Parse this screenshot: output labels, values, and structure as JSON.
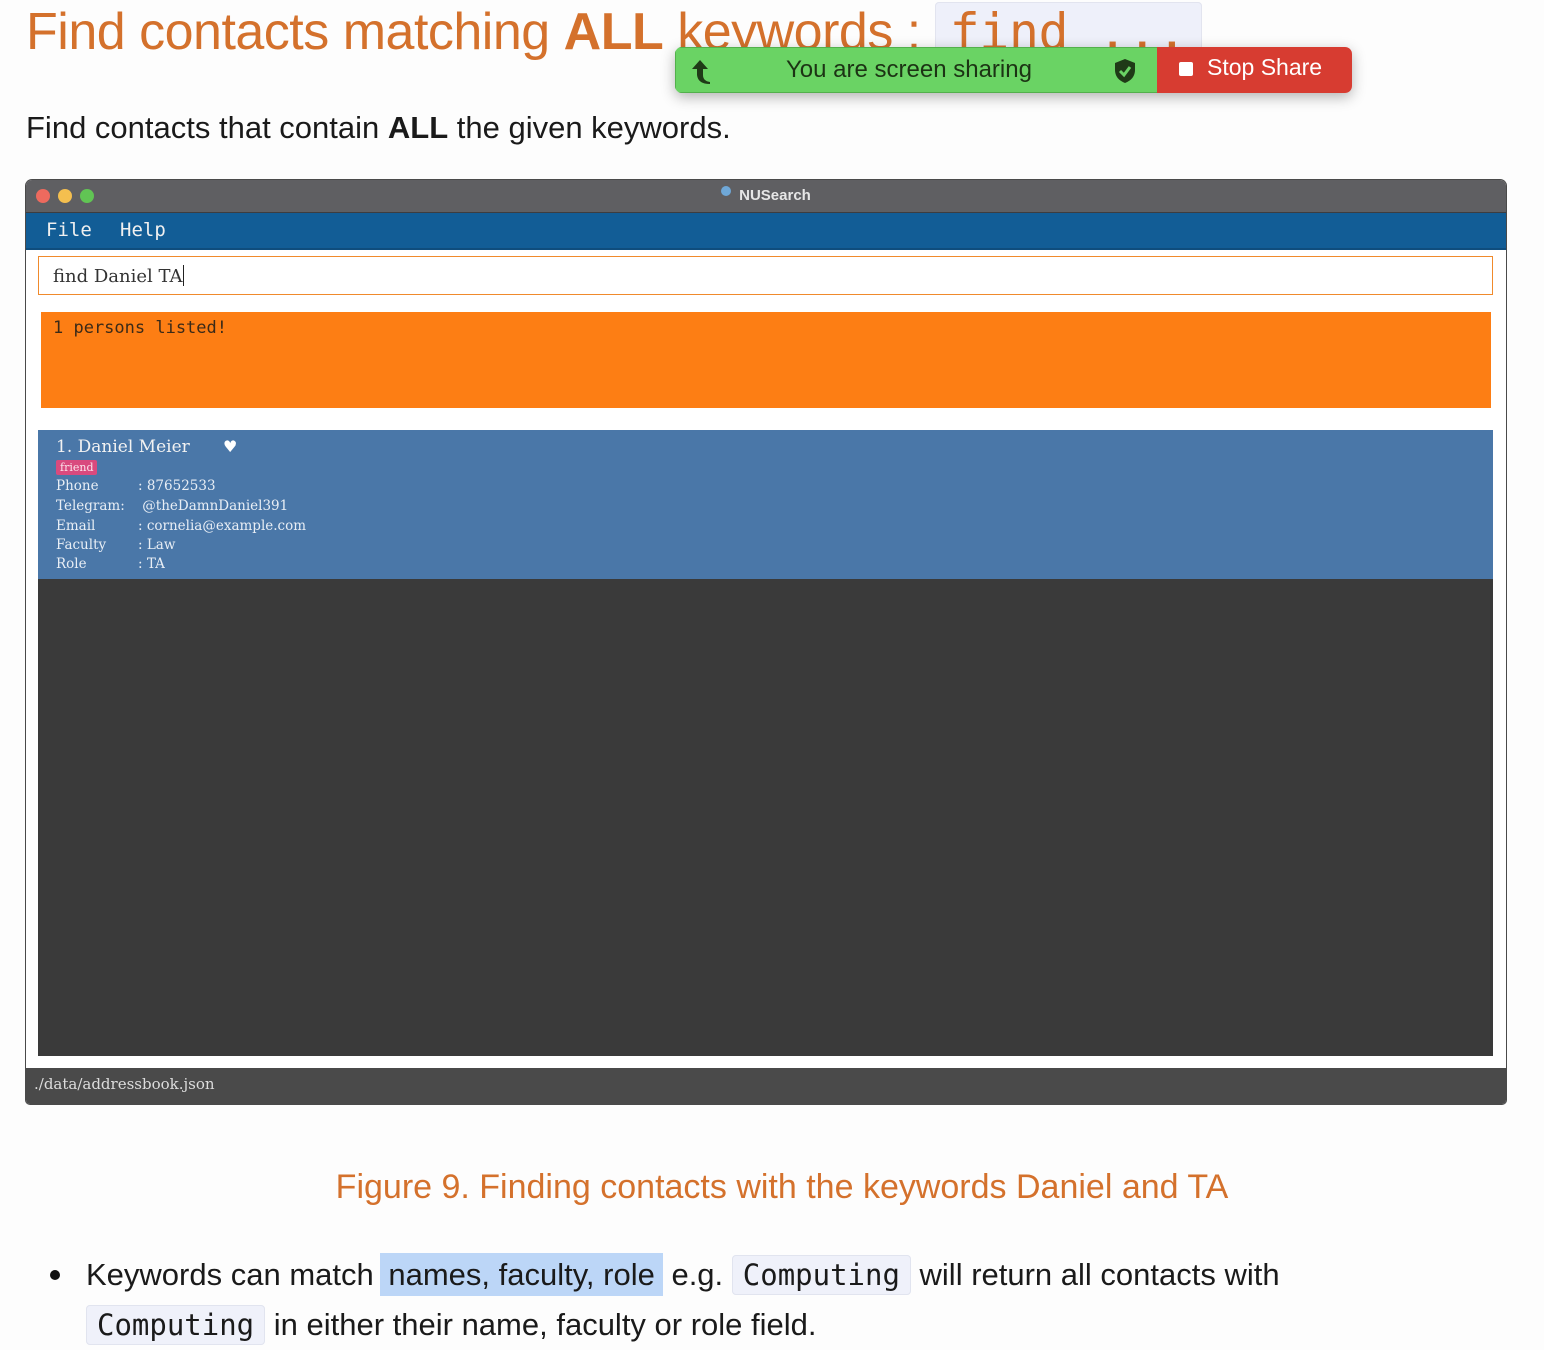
{
  "doc": {
    "heading_pre": "Find contacts matching ",
    "heading_bold": "ALL",
    "heading_mid": " keywords : ",
    "heading_code": "find ...",
    "intro_pre": "Find contacts that contain ",
    "intro_bold": "ALL",
    "intro_post": " the given keywords.",
    "caption": "Figure 9. Finding contacts with the keywords Daniel and TA",
    "bullet_1": "Keywords can match ",
    "bullet_highlight": "names, faculty, role",
    "bullet_2": " e.g. ",
    "bullet_code_1": "Computing",
    "bullet_3": " will return all contacts with",
    "bullet_code_2": "Computing",
    "bullet_4": " in either their name, faculty or role field."
  },
  "share_bar": {
    "label": "You are screen sharing",
    "stop_label": "Stop Share",
    "green": "#6ad364",
    "red": "#d73c31"
  },
  "app": {
    "title": "NUSearch",
    "menu": [
      "File",
      "Help"
    ],
    "command": "find Daniel TA",
    "result": "1 persons listed!",
    "person": {
      "index_name": "1. Daniel Meier",
      "favourite_icon": "heart-icon",
      "tag": "friend",
      "fields": [
        {
          "label": "Phone",
          "sep": ": ",
          "value": "87652533"
        },
        {
          "label": "Telegram:",
          "sep": " ",
          "value": "@theDamnDaniel391"
        },
        {
          "label": "Email",
          "sep": ": ",
          "value": "cornelia@example.com"
        },
        {
          "label": "Faculty",
          "sep": ": ",
          "value": "Law"
        },
        {
          "label": "Role",
          "sep": ": ",
          "value": "TA"
        }
      ]
    },
    "status_path": "./data/addressbook.json",
    "colors": {
      "menubar": "#125d96",
      "result": "#fd7e14",
      "card": "#4a77a8",
      "tag": "#d94a7e"
    }
  }
}
